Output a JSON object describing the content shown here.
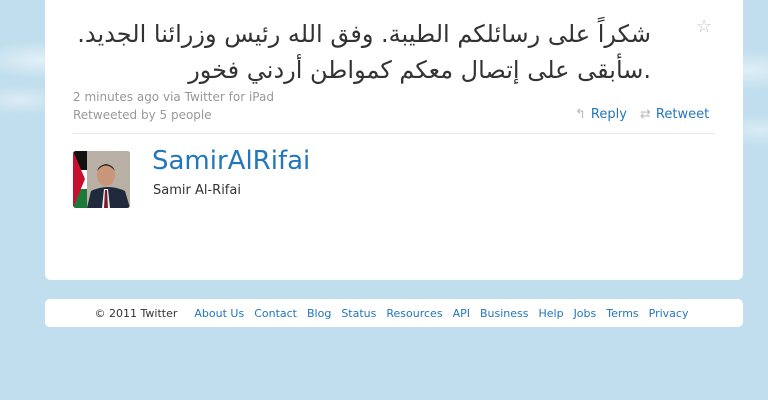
{
  "tweet": {
    "text_line1": "شكراً على رسائلكم الطيبة. وفق الله رئيس وزرائنا الجديد.",
    "text_line2": ".سأبقى على إتصال معكم كمواطن أردني فخور",
    "timestamp": "2 minutes ago",
    "via_label": "via",
    "client": "Twitter for iPad",
    "retweeted_by": "Retweeted by 5 people",
    "reply_label": "Reply",
    "retweet_label": "Retweet",
    "star_icon": "star-icon",
    "reply_icon": "reply-arrow-icon",
    "retweet_icon": "retweet-icon"
  },
  "user": {
    "screen_name": "SamirAlRifai",
    "full_name": "Samir Al-Rifai"
  },
  "footer": {
    "copyright": "© 2011 Twitter",
    "links": [
      "About Us",
      "Contact",
      "Blog",
      "Status",
      "Resources",
      "API",
      "Business",
      "Help",
      "Jobs",
      "Terms",
      "Privacy"
    ]
  },
  "colors": {
    "background": "#c0deed",
    "link": "#2276bb",
    "muted": "#999999"
  }
}
